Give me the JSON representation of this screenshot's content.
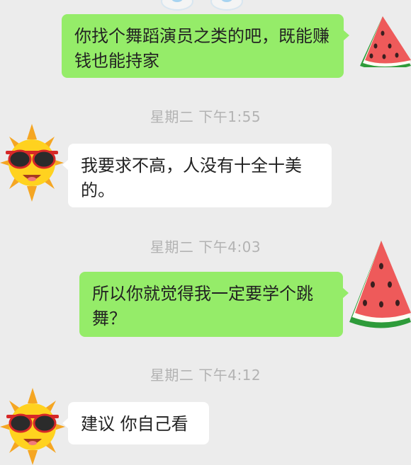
{
  "messages": [
    {
      "side": "sent",
      "text": "你找个舞蹈演员之类的吧，既能赚钱也能持家"
    },
    {
      "side": "recv",
      "text": "我要求不高，人没有十全十美的。"
    },
    {
      "side": "sent",
      "text": "所以你就觉得我一定要学个跳舞？"
    },
    {
      "side": "recv",
      "text": "建议 你自己看"
    }
  ],
  "timestamps": [
    "星期二 下午1:55",
    "星期二 下午4:03",
    "星期二 下午4:12"
  ],
  "avatars": {
    "self": "watermelon-avatar",
    "other": "sun-sunglasses-avatar"
  },
  "colors": {
    "background": "#ececec",
    "sent_bubble": "#95ec69",
    "received_bubble": "#ffffff",
    "timestamp": "#b3b3b3"
  }
}
